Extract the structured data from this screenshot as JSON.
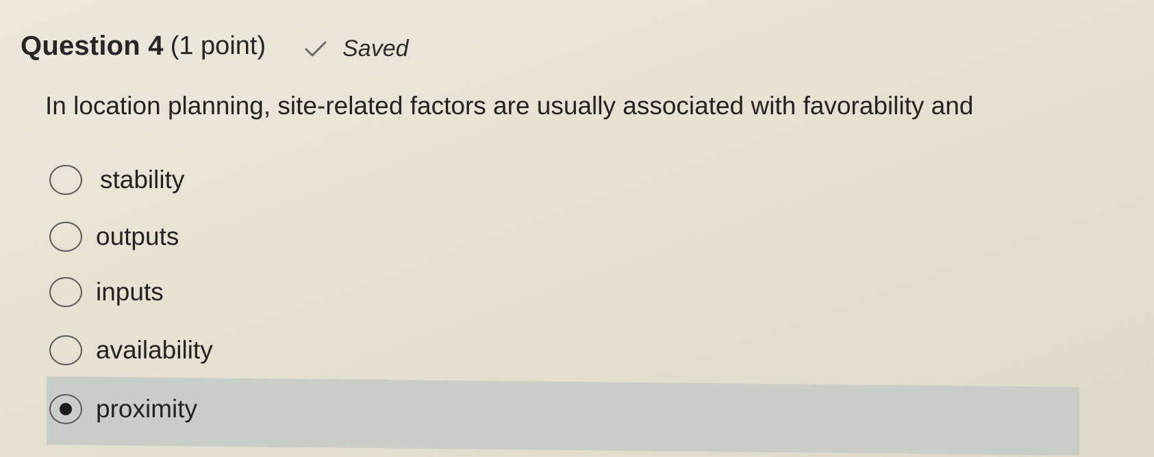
{
  "question": {
    "title": "Question 4",
    "points": "(1 point)",
    "status": "Saved",
    "status_icon": "check-icon",
    "text": "In location planning, site-related factors are usually associated with favorability and"
  },
  "options": [
    {
      "label": "stability",
      "selected": false
    },
    {
      "label": "outputs",
      "selected": false
    },
    {
      "label": "inputs",
      "selected": false
    },
    {
      "label": "availability",
      "selected": false
    },
    {
      "label": "proximity",
      "selected": true
    }
  ],
  "colors": {
    "background": "#e6e1d2",
    "selected_band": "#c9cec8",
    "text": "#222222"
  }
}
